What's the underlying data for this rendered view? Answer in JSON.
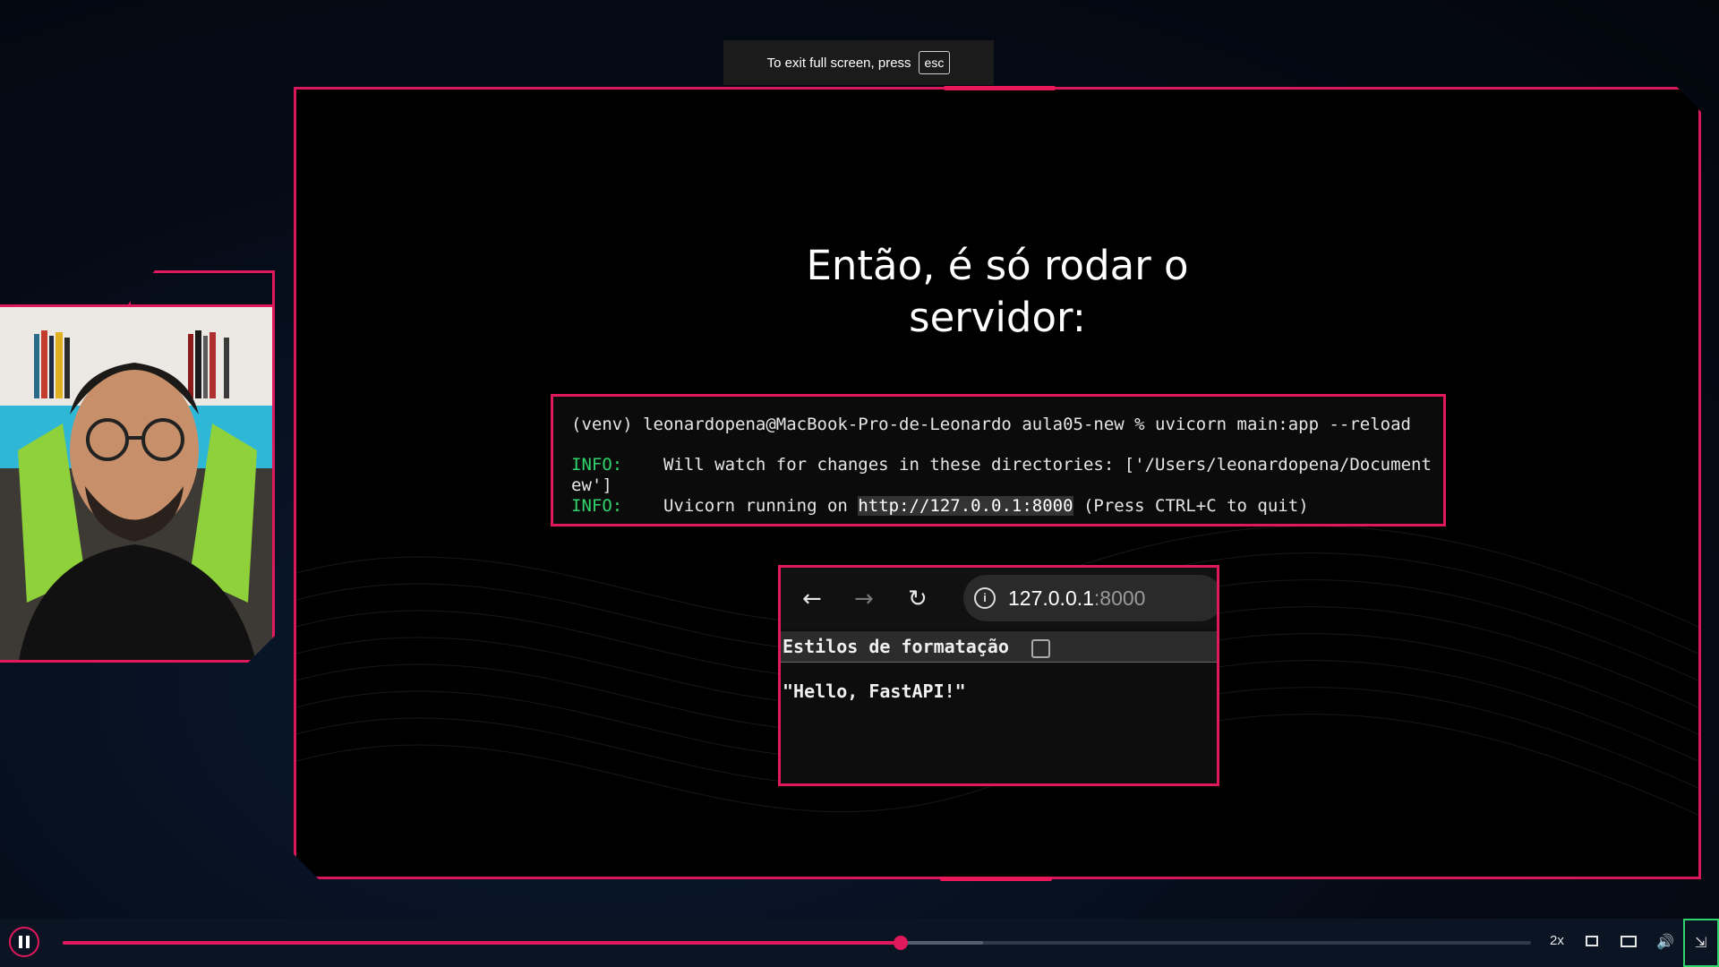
{
  "fullscreen_toast": {
    "text": "To exit full screen, press",
    "key": "esc"
  },
  "slide": {
    "title_line1": "Então, é só rodar o",
    "title_line2": "servidor:",
    "terminal": {
      "prompt_line": "(venv) leonardopena@MacBook-Pro-de-Leonardo aula05-new % uvicorn main:app --reload",
      "info_label": "INFO:",
      "line1_text": "    Will watch for changes in these directories: ['/Users/leonardopena/Document",
      "line1_wrap": "ew']",
      "line2_before": "    Uvicorn running on ",
      "line2_url": "http://127.0.0.1:8000",
      "line2_after": " (Press CTRL+C to quit)"
    },
    "browser": {
      "address_host": "127.0.0.1",
      "address_port": ":8000",
      "formatting_label": "Estilos de formatação",
      "response": "\"Hello, FastAPI!\""
    }
  },
  "player": {
    "speed": "2x",
    "progress": 0.571,
    "buffered": 0.627,
    "accent_color": "#e0185c"
  }
}
